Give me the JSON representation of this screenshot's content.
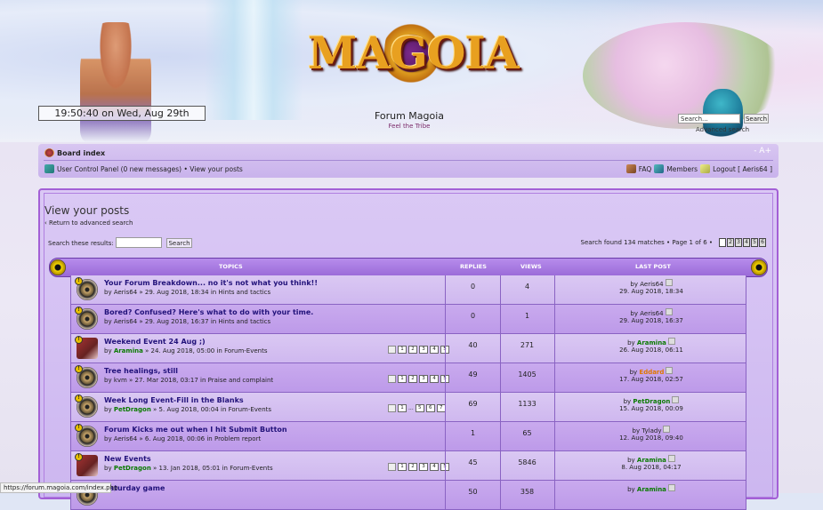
{
  "header": {
    "clock": "19:50:40 on Wed, Aug 29th",
    "logo_text": "MAGOIA",
    "site_title": "Forum Magoia",
    "site_desc": "Feel the Tribe",
    "search_placeholder": "Search...",
    "search_btn": "Search",
    "advanced": "Advanced search"
  },
  "nav": {
    "board_index": "Board index",
    "font_size": "- A+",
    "ucp": "User Control Panel (0 new messages) • View your posts",
    "faq": "FAQ",
    "members": "Members",
    "logout": "Logout [ Aeris64 ]"
  },
  "page": {
    "title": "View your posts",
    "back": "‹ Return to advanced search",
    "search_label": "Search these results:",
    "search_btn": "Search",
    "matches": "Search found 134 matches • Page 1 of 6 •",
    "pages": [
      "1",
      "2",
      "3",
      "4",
      "5",
      "6"
    ]
  },
  "table": {
    "headers": {
      "topics": "TOPICS",
      "replies": "REPLIES",
      "views": "VIEWS",
      "last_post": "LAST POST"
    },
    "rows": [
      {
        "title": "Your Forum Breakdown... no it's not what you think!!",
        "author": "Aeris64",
        "author_color": "normal",
        "meta": " » 29. Aug 2018, 18:34 in Hints and tactics",
        "pages": [],
        "replies": "0",
        "views": "4",
        "last_user": "Aeris64",
        "last_user_color": "normal",
        "last_date": "29. Aug 2018, 18:34",
        "icon": "round"
      },
      {
        "title": "Bored? Confused? Here's what to do with your time.",
        "author": "Aeris64",
        "author_color": "normal",
        "meta": " » 29. Aug 2018, 16:37 in Hints and tactics",
        "pages": [],
        "replies": "0",
        "views": "1",
        "last_user": "Aeris64",
        "last_user_color": "normal",
        "last_date": "29. Aug 2018, 16:37",
        "icon": "round"
      },
      {
        "title": "Weekend Event 24 Aug ;)",
        "author": "Aramina",
        "author_color": "green",
        "meta": " » 24. Aug 2018, 05:00 in Forum-Events",
        "pages": [
          "1",
          "2",
          "3",
          "4",
          "5"
        ],
        "replies": "40",
        "views": "271",
        "last_user": "Aramina",
        "last_user_color": "green",
        "last_date": "26. Aug 2018, 06:11",
        "icon": "pic"
      },
      {
        "title": "Tree healings, still",
        "author": "kvm",
        "author_color": "normal",
        "meta": " » 27. Mar 2018, 03:17 in Praise and complaint",
        "pages": [
          "1",
          "2",
          "3",
          "4",
          "5"
        ],
        "replies": "49",
        "views": "1405",
        "last_user": "Eddard",
        "last_user_color": "orange",
        "last_date": "17. Aug 2018, 02:57",
        "icon": "round"
      },
      {
        "title": "Week Long Event-Fill in the Blanks",
        "author": "PetDragon",
        "author_color": "green",
        "meta": " » 5. Aug 2018, 00:04 in Forum-Events",
        "pages": [
          "1",
          "...",
          "5",
          "6",
          "7"
        ],
        "replies": "69",
        "views": "1133",
        "last_user": "PetDragon",
        "last_user_color": "green",
        "last_date": "15. Aug 2018, 00:09",
        "icon": "round"
      },
      {
        "title": "Forum Kicks me out when I hit Submit Button",
        "author": "Aeris64",
        "author_color": "normal",
        "meta": " » 6. Aug 2018, 00:06 in Problem report",
        "pages": [],
        "replies": "1",
        "views": "65",
        "last_user": "Tylady",
        "last_user_color": "normal",
        "last_date": "12. Aug 2018, 09:40",
        "icon": "round"
      },
      {
        "title": "New Events",
        "author": "PetDragon",
        "author_color": "green",
        "meta": " » 13. Jan 2018, 05:01 in Forum-Events",
        "pages": [
          "1",
          "2",
          "3",
          "4",
          "5"
        ],
        "replies": "45",
        "views": "5846",
        "last_user": "Aramina",
        "last_user_color": "green",
        "last_date": "8. Aug 2018, 04:17",
        "icon": "pic"
      },
      {
        "title": "Saturday game",
        "author": "",
        "author_color": "normal",
        "meta": "",
        "pages": [],
        "replies": "50",
        "views": "358",
        "last_user": "Aramina",
        "last_user_color": "green",
        "last_date": "",
        "icon": "round"
      }
    ]
  },
  "status_url": "https://forum.magoia.com/index.php"
}
